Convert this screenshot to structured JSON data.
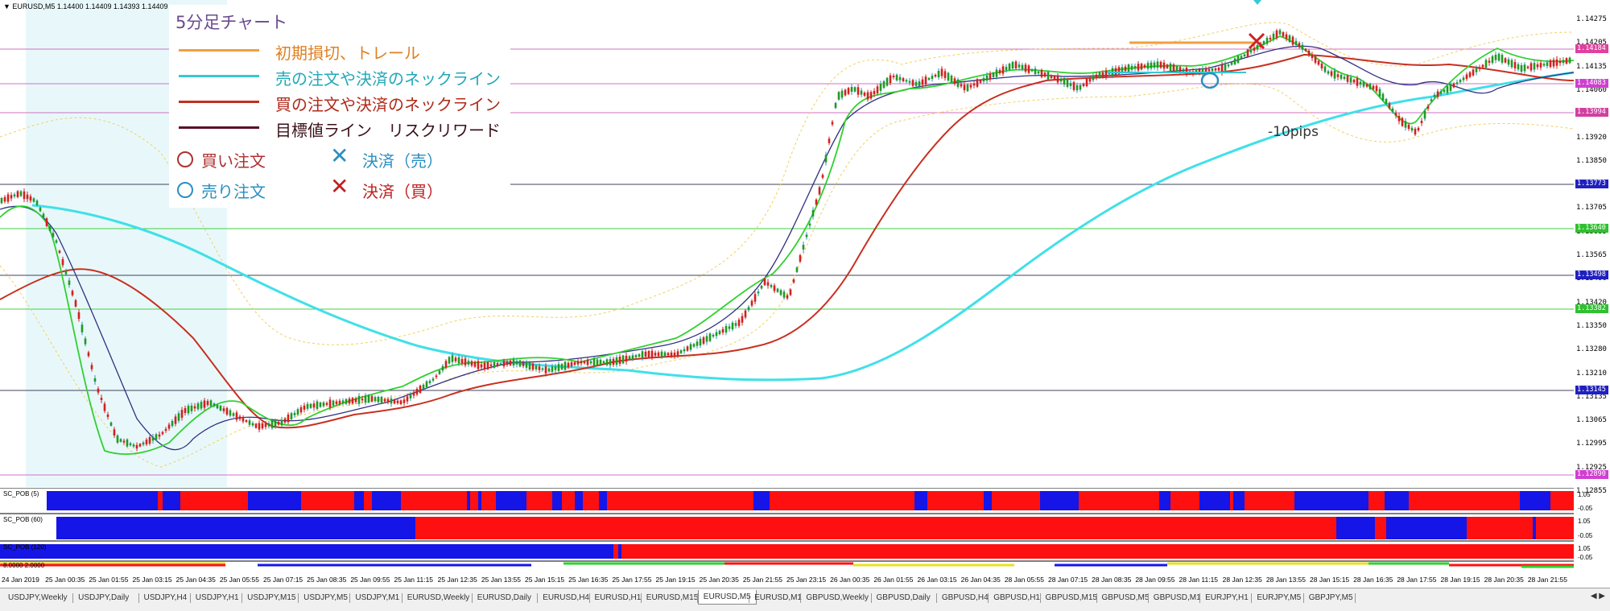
{
  "header": {
    "symbol_info": "▼ EURUSD,M5  1.14400 1.14409 1.14393 1.14409"
  },
  "legend": {
    "title": "5分足チャート",
    "items": [
      {
        "label": "初期損切、トレール",
        "color": "#f0a040"
      },
      {
        "label": "売の注文や決済のネックライン",
        "color": "#36c8d6"
      },
      {
        "label": "買の注文や決済のネックライン",
        "color": "#c03020"
      },
      {
        "label": "目標値ライン　リスクリワード",
        "color": "#5a1028"
      }
    ],
    "symbols": {
      "buy_order": "買い注文",
      "sell_order": "売り注文",
      "close_sell": "決済（売）",
      "close_buy": "決済（買）"
    },
    "symbol_colors": {
      "buy": "#b03030",
      "sell": "#2a8fc0",
      "close_sell": "#2a8fc0",
      "close_buy": "#c02020"
    }
  },
  "annotation": {
    "pips_note": "-10pips"
  },
  "price_axis": {
    "ticks": [
      "1.14275",
      "1.14205",
      "1.14135",
      "1.14060",
      "1.13990",
      "1.13920",
      "1.13850",
      "1.13775",
      "1.13705",
      "1.13635",
      "1.13565",
      "1.13490",
      "1.13420",
      "1.13350",
      "1.13280",
      "1.13210",
      "1.13135",
      "1.13065",
      "1.12995",
      "1.12925",
      "1.12855"
    ],
    "highlighted": [
      {
        "label": "1.14184",
        "color": "#e040a0"
      },
      {
        "label": "1.14083",
        "color": "#d040d0"
      },
      {
        "label": "1.13994",
        "color": "#d040a0"
      },
      {
        "label": "1.13773",
        "color": "#2020c0"
      },
      {
        "label": "1.13640",
        "color": "#30c030"
      },
      {
        "label": "1.13498",
        "color": "#2020c0"
      },
      {
        "label": "1.13382",
        "color": "#30c030"
      },
      {
        "label": "1.13145",
        "color": "#2020c0"
      },
      {
        "label": "1.12890",
        "color": "#d040d0"
      }
    ]
  },
  "time_axis": {
    "labels": [
      "24 Jan 2019",
      "25 Jan 00:35",
      "25 Jan 01:55",
      "25 Jan 03:15",
      "25 Jan 04:35",
      "25 Jan 05:55",
      "25 Jan 07:15",
      "25 Jan 08:35",
      "25 Jan 09:55",
      "25 Jan 11:15",
      "25 Jan 12:35",
      "25 Jan 13:55",
      "25 Jan 15:15",
      "25 Jan 16:35",
      "25 Jan 17:55",
      "25 Jan 19:15",
      "25 Jan 20:35",
      "25 Jan 21:55",
      "25 Jan 23:15",
      "26 Jan 00:35",
      "26 Jan 01:55",
      "26 Jan 03:15",
      "26 Jan 04:35",
      "28 Jan 05:55",
      "28 Jan 07:15",
      "28 Jan 08:35",
      "28 Jan 09:55",
      "28 Jan 11:15",
      "28 Jan 12:35",
      "28 Jan 13:55",
      "28 Jan 15:15",
      "28 Jan 16:35",
      "28 Jan 17:55",
      "28 Jan 19:15",
      "28 Jan 20:35",
      "28 Jan 21:55"
    ]
  },
  "indicators": [
    {
      "label": "SC_POB (5)",
      "right_top": "1.05",
      "right_bottom": "-0.05"
    },
    {
      "label": "SC_POB (60)",
      "right_top": "1.05",
      "right_bottom": "-0.05"
    },
    {
      "label": "SC_POB (120)",
      "right_top": "1.05",
      "right_bottom": "-0.05"
    },
    {
      "label": "8.0000 2.0000",
      "right_top": "",
      "right_bottom": ""
    }
  ],
  "tabs": [
    {
      "label": "USDJPY,Weekly",
      "active": false
    },
    {
      "label": "USDJPY,Daily",
      "active": false
    },
    {
      "label": "USDJPY,H4",
      "active": false
    },
    {
      "label": "USDJPY,H1",
      "active": false
    },
    {
      "label": "USDJPY,M15",
      "active": false
    },
    {
      "label": "USDJPY,M5",
      "active": false
    },
    {
      "label": "USDJPY,M1",
      "active": false
    },
    {
      "label": "EURUSD,Weekly",
      "active": false
    },
    {
      "label": "EURUSD,Daily",
      "active": false
    },
    {
      "label": "EURUSD,H4",
      "active": false
    },
    {
      "label": "EURUSD,H1",
      "active": false
    },
    {
      "label": "EURUSD,M15",
      "active": false
    },
    {
      "label": "EURUSD,M5",
      "active": true
    },
    {
      "label": "EURUSD,M1",
      "active": false
    },
    {
      "label": "GBPUSD,Weekly",
      "active": false
    },
    {
      "label": "GBPUSD,Daily",
      "active": false
    },
    {
      "label": "GBPUSD,H4",
      "active": false
    },
    {
      "label": "GBPUSD,H1",
      "active": false
    },
    {
      "label": "GBPUSD,M15",
      "active": false
    },
    {
      "label": "GBPUSD,M5",
      "active": false
    },
    {
      "label": "GBPUSD,M1",
      "active": false
    },
    {
      "label": "EURJPY,H1",
      "active": false
    },
    {
      "label": "EURJPY,M5",
      "active": false
    },
    {
      "label": "GBPJPY,M5",
      "active": false
    }
  ],
  "tab_scroll": "◀ ▶"
}
